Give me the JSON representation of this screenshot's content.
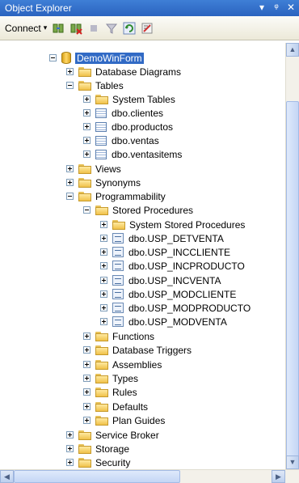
{
  "panel": {
    "title": "Object Explorer",
    "pin_glyph": "▾",
    "autohide_glyph": "ᵠ",
    "close_glyph": "✕"
  },
  "toolbar": {
    "connect_label": "Connect",
    "connect_caret": "▾"
  },
  "tree": {
    "database": "DemoWinForm",
    "database_diagrams": "Database Diagrams",
    "tables": "Tables",
    "system_tables": "System Tables",
    "table_items": [
      "dbo.clientes",
      "dbo.productos",
      "dbo.ventas",
      "dbo.ventasitems"
    ],
    "views": "Views",
    "synonyms": "Synonyms",
    "programmability": "Programmability",
    "stored_procedures": "Stored Procedures",
    "system_stored_procedures": "System Stored Procedures",
    "procedures": [
      "dbo.USP_DETVENTA",
      "dbo.USP_INCCLIENTE",
      "dbo.USP_INCPRODUCTO",
      "dbo.USP_INCVENTA",
      "dbo.USP_MODCLIENTE",
      "dbo.USP_MODPRODUCTO",
      "dbo.USP_MODVENTA"
    ],
    "programmability_items": [
      "Functions",
      "Database Triggers",
      "Assemblies",
      "Types",
      "Rules",
      "Defaults",
      "Plan Guides"
    ],
    "service_broker": "Service Broker",
    "storage": "Storage",
    "security": "Security"
  },
  "scroll": {
    "up": "▲",
    "down": "▼",
    "left": "◀",
    "right": "▶"
  },
  "colors": {
    "title_bar": "#2a63bf",
    "selection": "#316ac5",
    "folder": "#f0c24a"
  }
}
